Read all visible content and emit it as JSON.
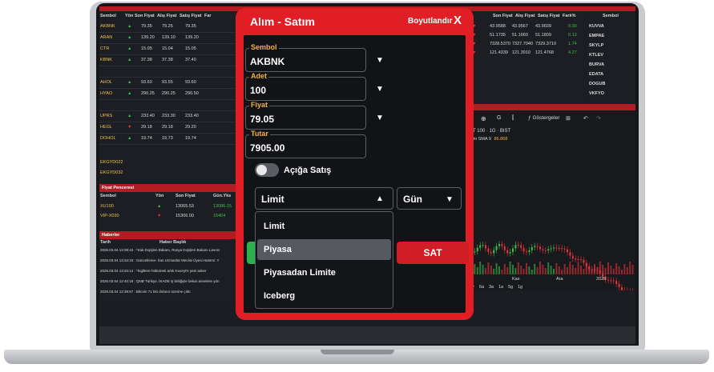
{
  "modal": {
    "title": "Alım - Satım",
    "resize_label": "Boyutlandır",
    "close_label": "X",
    "symbol": {
      "label": "Sembol",
      "value": "AKBNK"
    },
    "quantity": {
      "label": "Adet",
      "value": "100"
    },
    "price": {
      "label": "Fiyat",
      "value": "79.05"
    },
    "total": {
      "label": "Tutar",
      "value": "7905.00"
    },
    "short_sell_label": "Açığa Satış",
    "short_sell_on": false,
    "order_type": "Limit",
    "validity": "Gün",
    "order_type_options": [
      "Limit",
      "Piyasa",
      "Piyasadan Limite",
      "Iceberg"
    ],
    "selected_option": "Piyasa",
    "sell_label": "SAT"
  },
  "left_table": {
    "headers": [
      "Sembol",
      "Yön",
      "Son Fiyat",
      "Alış Fiyat",
      "Satış Fiyat",
      "Far"
    ],
    "rows": [
      {
        "sym": "AKBNK",
        "dir": "up",
        "last": "79.35",
        "bid": "79.25",
        "ask": "79.35"
      },
      {
        "sym": "ARAN",
        "dir": "up",
        "last": "139.20",
        "bid": "139.10",
        "ask": "139.20"
      },
      {
        "sym": "CTR",
        "dir": "up",
        "last": "15.05",
        "bid": "15.04",
        "ask": "15.05"
      },
      {
        "sym": "KBNK",
        "dir": "up",
        "last": "37.38",
        "bid": "37.38",
        "ask": "37.40"
      },
      {
        "sym": "",
        "dir": "",
        "last": "",
        "bid": "",
        "ask": ""
      },
      {
        "sym": "AHOL",
        "dir": "up",
        "last": "93.60",
        "bid": "93.55",
        "ask": "93.60"
      },
      {
        "sym": "HYAO",
        "dir": "up",
        "last": "290.25",
        "bid": "290.25",
        "ask": "290.50"
      },
      {
        "sym": "",
        "dir": "",
        "last": "",
        "bid": "",
        "ask": ""
      },
      {
        "sym": "UPRS",
        "dir": "up",
        "last": "233.40",
        "bid": "233.30",
        "ask": "233.40"
      },
      {
        "sym": "HEGL",
        "dir": "down",
        "last": "29.18",
        "bid": "29.18",
        "ask": "29.20"
      },
      {
        "sym": "DOHOL",
        "dir": "up",
        "last": "19.74",
        "bid": "19.73",
        "ask": "19.74"
      }
    ],
    "extra_rows": [
      "EKGYD022",
      "EKGYD032"
    ]
  },
  "price_window": {
    "title": "Fiyat Penceresi",
    "headers": [
      "Sembol",
      "Yön",
      "Son Fiyat",
      "Gün.Yks"
    ],
    "rows": [
      {
        "sym": "XU100",
        "dir": "up",
        "last": "13065.53",
        "high": "13086.15"
      },
      {
        "sym": "VIP-X030",
        "dir": "down",
        "last": "15306.00",
        "high": "15404"
      }
    ]
  },
  "news": {
    "title": "Haberler",
    "headers": [
      "Tarih",
      "Haber Başlık"
    ],
    "rows": [
      "2026.03.04 13:38:42 : *Irak Dışişleri Bakanı, Rusya Dışişleri Bakanı Lavrov",
      "2026.03.04 13:34:33 : Güncelleme- İran Uzmanlar Meclisi Üyesi Hatemi: Y",
      "2026.03.04 13:34:14 : *İngiltere hükümeti artık Kuveyt'e yeni asker",
      "2026.03.04 12:40:18 : QNB Türkiye, İKADE iş birliğiyle bekar annelere yön",
      "2026.03.04 12:39:57 : Bitcoin 71 bin doların üzerine çıktı"
    ]
  },
  "right_table": {
    "headers": [
      "Son Fiyat",
      "Alış Fiyat",
      "Satış Fiyat",
      "Fark%"
    ],
    "rows": [
      {
        "last": "43.9588",
        "bid": "43.9567",
        "ask": "43.9609",
        "chg": "0.00"
      },
      {
        "last": "51.1735",
        "bid": "51.1660",
        "ask": "51.1809",
        "chg": "0.13"
      },
      {
        "last": "7328.5370",
        "bid": "7327.7040",
        "ask": "7329.3710",
        "chg": "1.74"
      },
      {
        "last": "121.4339",
        "bid": "121.3910",
        "ask": "121.4768",
        "chg": "4.27"
      }
    ]
  },
  "side_list": {
    "header": "Sembol",
    "items": [
      "KUVVA",
      "EMPAE",
      "SKYLP",
      "KTLEV",
      "BURVA",
      "EDATA",
      "DOGUB",
      "VKFYO"
    ]
  },
  "chart": {
    "toolbar": {
      "indicators_label": "Göstergeler"
    },
    "legend": "ST 100 · 1G · BIST",
    "sma_label": "dım SMA 9",
    "sma_value": "86.868",
    "x_ticks": [
      "Kas",
      "Ara",
      "2026"
    ],
    "ranges": [
      "1y",
      "6a",
      "3a",
      "1a",
      "5g",
      "1g"
    ]
  },
  "colors": {
    "accent_red": "#e11d26",
    "sell_red": "#d11d25",
    "label_orange": "#f6b23c",
    "up_green": "#3cc04a",
    "down_red": "#e5333a"
  }
}
